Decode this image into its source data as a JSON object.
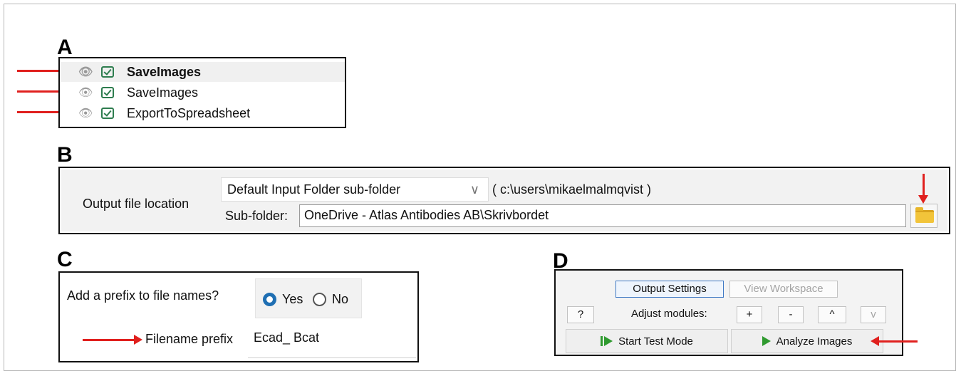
{
  "panel_labels": {
    "a": "A",
    "b": "B",
    "c": "C",
    "d": "D"
  },
  "panel_a": {
    "modules": [
      {
        "name": "SaveImages",
        "selected": true,
        "enabled": true
      },
      {
        "name": "SaveImages",
        "selected": false,
        "enabled": true
      },
      {
        "name": "ExportToSpreadsheet",
        "selected": false,
        "enabled": true
      }
    ]
  },
  "panel_b": {
    "output_location_label": "Output file location",
    "location_select_value": "Default Input Folder sub-folder",
    "location_path": "( c:\\users\\mikaelmalmqvist )",
    "subfolder_label": "Sub-folder:",
    "subfolder_value": "OneDrive - Atlas Antibodies AB\\Skrivbordet"
  },
  "panel_c": {
    "prefix_question": "Add a prefix to file names?",
    "option_yes": "Yes",
    "option_no": "No",
    "selected_option": "Yes",
    "filename_prefix_label": "Filename prefix",
    "filename_prefix_value": "Ecad_ Bcat"
  },
  "panel_d": {
    "tab_output_settings": "Output Settings",
    "tab_view_workspace": "View Workspace",
    "help_button": "?",
    "adjust_modules_label": "Adjust modules:",
    "add_button": "+",
    "remove_button": "-",
    "move_up_button": "^",
    "move_down_button": "v",
    "start_test_mode": "Start Test Mode",
    "analyze_images": "Analyze Images"
  },
  "colors": {
    "arrow": "#e0201e",
    "accent": "#1f6fb3",
    "play": "#2f9a2f",
    "folder": "#f2c43a"
  }
}
